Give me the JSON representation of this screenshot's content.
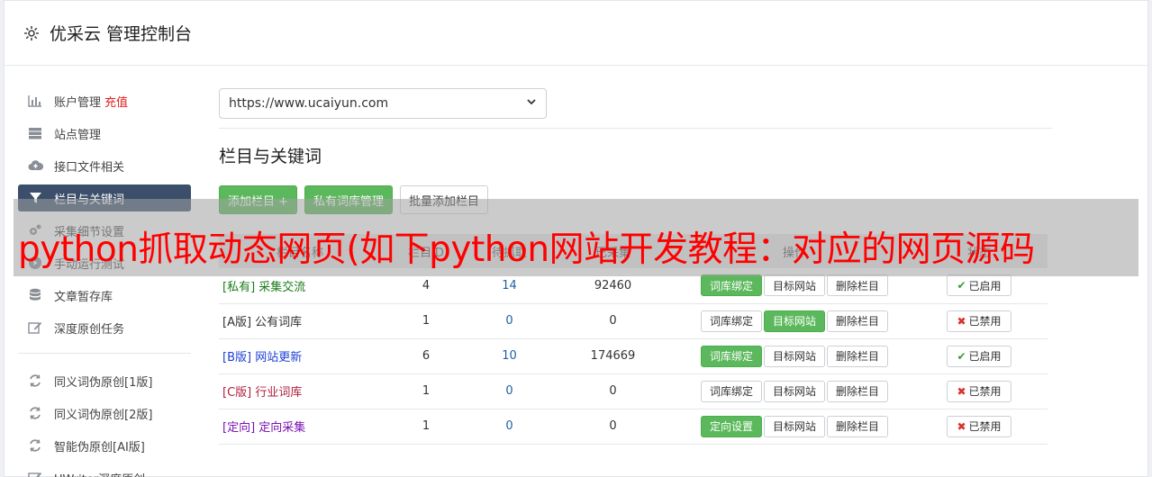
{
  "header": {
    "title": "优采云 管理控制台"
  },
  "sidebar": {
    "items": [
      {
        "icon": "bar-chart-icon",
        "label": "账户管理",
        "extra": "充值"
      },
      {
        "icon": "server-icon",
        "label": "站点管理"
      },
      {
        "icon": "cloud-upload-icon",
        "label": "接口文件相关"
      },
      {
        "icon": "filter-icon",
        "label": "栏目与关键词",
        "active": true
      },
      {
        "icon": "cogs-icon",
        "label": "采集细节设置"
      },
      {
        "icon": "play-circle-icon",
        "label": "手动运行测试"
      },
      {
        "icon": "database-icon",
        "label": "文章暂存库"
      },
      {
        "icon": "edit-icon",
        "label": "深度原创任务"
      }
    ],
    "items2": [
      {
        "icon": "refresh-icon",
        "label": "同义词伪原创[1版]"
      },
      {
        "icon": "refresh-icon",
        "label": "同义词伪原创[2版]"
      },
      {
        "icon": "refresh-icon",
        "label": "智能伪原创[AI版]"
      },
      {
        "icon": "edit-icon",
        "label": "UWriter深度原创"
      }
    ]
  },
  "main": {
    "site_select": "https://www.ucaiyun.com",
    "section_title": "栏目与关键词",
    "toolbar": {
      "add_column": "添加栏目 +",
      "private_lib": "私有词库管理",
      "batch_add": "批量添加栏目"
    },
    "table": {
      "headers": [
        "栏目名称",
        "栏目ID",
        "待抓取",
        "已采集",
        "操作",
        "状态"
      ],
      "rows": [
        {
          "tag": "[私有]",
          "name": "采集交流",
          "color": "#1a7d1a",
          "id": "4",
          "pending": "14",
          "collected": "92460",
          "btn1": "词库绑定",
          "btn1_green": true,
          "btn2": "目标网站",
          "btn2_green": false,
          "btn3": "删除栏目",
          "status": "已启用",
          "on": true
        },
        {
          "tag": "[A版]",
          "name": "公有词库",
          "color": "#333333",
          "id": "1",
          "pending": "0",
          "collected": "0",
          "btn1": "词库绑定",
          "btn1_green": false,
          "btn2": "目标网站",
          "btn2_green": true,
          "btn3": "删除栏目",
          "status": "已禁用",
          "on": false
        },
        {
          "tag": "[B版]",
          "name": "网站更新",
          "color": "#1e3fd4",
          "id": "6",
          "pending": "10",
          "collected": "174669",
          "btn1": "词库绑定",
          "btn1_green": true,
          "btn2": "目标网站",
          "btn2_green": false,
          "btn3": "删除栏目",
          "status": "已启用",
          "on": true
        },
        {
          "tag": "[C版]",
          "name": "行业词库",
          "color": "#b01f3c",
          "id": "1",
          "pending": "0",
          "collected": "0",
          "btn1": "词库绑定",
          "btn1_green": false,
          "btn2": "目标网站",
          "btn2_green": false,
          "btn3": "删除栏目",
          "status": "已禁用",
          "on": false
        },
        {
          "tag": "[定向]",
          "name": "定向采集",
          "color": "#7a12b0",
          "id": "1",
          "pending": "0",
          "collected": "0",
          "btn1": "定向设置",
          "btn1_green": true,
          "btn2": "目标网站",
          "btn2_green": false,
          "btn3": "删除栏目",
          "status": "已禁用",
          "on": false
        }
      ]
    }
  },
  "overlay": {
    "text": "python抓取动态网页(如下python网站开发教程：对应的网页源码"
  }
}
